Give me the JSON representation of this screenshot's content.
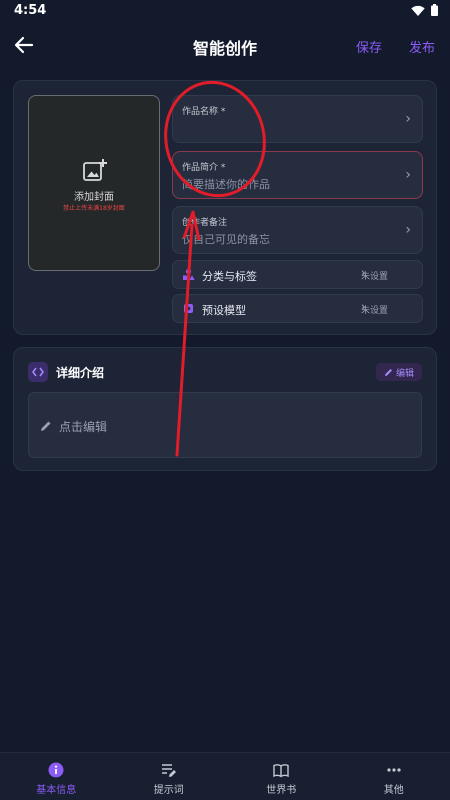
{
  "status_bar": {
    "time": "4:54"
  },
  "header": {
    "title": "智能创作",
    "save_label": "保存",
    "publish_label": "发布"
  },
  "cover": {
    "label": "添加封面",
    "warning": "禁止上传未满18岁封面"
  },
  "fields": [
    {
      "label": "作品名称 *",
      "value": "",
      "placeholder": ""
    },
    {
      "label": "作品简介 *",
      "value": "简要描述你的作品"
    },
    {
      "label": "创作者备注",
      "value": "仅自己可见的备忘"
    }
  ],
  "options": [
    {
      "label": "分类与标签",
      "value": "未设置"
    },
    {
      "label": "预设模型",
      "value": "未设置"
    }
  ],
  "detail": {
    "title": "详细介绍",
    "edit_label": "编辑",
    "placeholder": "点击编辑"
  },
  "bottom_nav": [
    {
      "label": "基本信息",
      "icon": "info-icon",
      "active": true
    },
    {
      "label": "提示词",
      "icon": "prompt-icon",
      "active": false
    },
    {
      "label": "世界书",
      "icon": "book-icon",
      "active": false
    },
    {
      "label": "其他",
      "icon": "more-icon",
      "active": false
    }
  ],
  "colors": {
    "accent": "#8b5cf6",
    "background": "#131a2c",
    "card": "#1d2436",
    "annotation": "#e11d2a",
    "warning": "#ef4444"
  }
}
